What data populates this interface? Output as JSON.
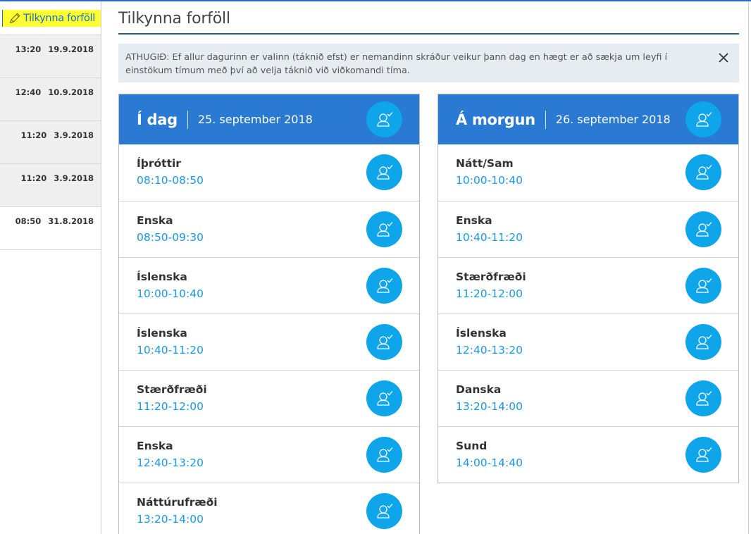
{
  "sidebar": {
    "report_link": "Tilkynna forföll",
    "history": [
      {
        "time": "13:20",
        "date": "19.9.2018"
      },
      {
        "time": "12:40",
        "date": "10.9.2018"
      },
      {
        "time": "11:20",
        "date": "3.9.2018"
      },
      {
        "time": "11:20",
        "date": "3.9.2018"
      },
      {
        "time": "08:50",
        "date": "31.8.2018"
      }
    ]
  },
  "header": {
    "title": "Tilkynna forföll"
  },
  "notice": {
    "text": "ATHUGIÐ: Ef allur dagurinn er valinn (táknið efst) er nemandinn skráður veikur þann dag en hægt er að sækja um leyfi í einstökum tímum með því að velja táknið við viðkomandi tíma."
  },
  "today": {
    "day": "Í dag",
    "date": "25. september 2018",
    "lessons": [
      {
        "subject": "Íþróttir",
        "time": "08:10-08:50"
      },
      {
        "subject": "Enska",
        "time": "08:50-09:30"
      },
      {
        "subject": "Íslenska",
        "time": "10:00-10:40"
      },
      {
        "subject": "Íslenska",
        "time": "10:40-11:20"
      },
      {
        "subject": "Stærðfræði",
        "time": "11:20-12:00"
      },
      {
        "subject": "Enska",
        "time": "12:40-13:20"
      },
      {
        "subject": "Náttúrufræði",
        "time": "13:20-14:00"
      }
    ]
  },
  "tomorrow": {
    "day": "Á morgun",
    "date": "26. september 2018",
    "lessons": [
      {
        "subject": "Nátt/Sam",
        "time": "10:00-10:40"
      },
      {
        "subject": "Enska",
        "time": "10:40-11:20"
      },
      {
        "subject": "Stærðfræði",
        "time": "11:20-12:00"
      },
      {
        "subject": "Íslenska",
        "time": "12:40-13:20"
      },
      {
        "subject": "Danska",
        "time": "13:20-14:00"
      },
      {
        "subject": "Sund",
        "time": "14:00-14:40"
      }
    ]
  },
  "icons": {
    "report": "pencil-icon",
    "close": "close-icon",
    "select": "user-check-icon"
  },
  "colors": {
    "header_blue": "#2a7ad3",
    "button_blue": "#0ea5ea",
    "time_blue": "#1a9ae0",
    "highlight": "#ffff33"
  }
}
